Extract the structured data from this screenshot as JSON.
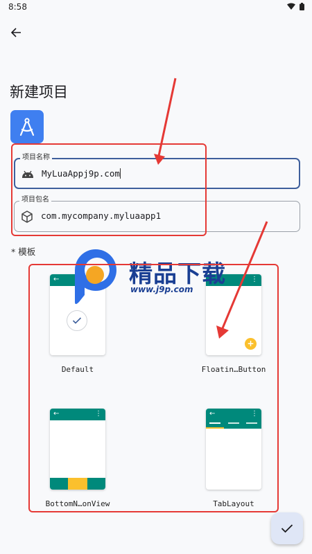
{
  "status_bar": {
    "time": "8:58"
  },
  "page": {
    "title": "新建项目"
  },
  "form": {
    "app_name": {
      "label": "项目名称",
      "value": "MyLuaAppj9p.com",
      "icon": "android-icon"
    },
    "package_name": {
      "label": "项目包名",
      "value": "com.mycompany.myluaapp1",
      "icon": "package-icon"
    }
  },
  "templates": {
    "section_label": "* 模板",
    "items": [
      {
        "name": "Default",
        "kind": "default"
      },
      {
        "name": "Floatin…Button",
        "kind": "fab"
      },
      {
        "name": "BottomN…onView",
        "kind": "bottom-nav"
      },
      {
        "name": "TabLayout",
        "kind": "tabs"
      }
    ]
  },
  "watermark": {
    "brand": "精品下载",
    "url": "www.j9p.com"
  },
  "colors": {
    "accent_blue": "#3e5f9c",
    "app_icon": "#3f7ff0",
    "template_bar": "#00897b",
    "template_highlight": "#fbc02d",
    "annotation_red": "#e53935"
  }
}
